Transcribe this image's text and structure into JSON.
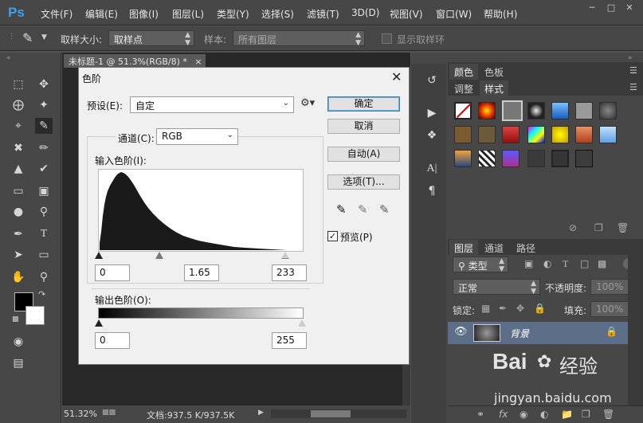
{
  "app": {
    "logo": "Ps"
  },
  "menu": [
    "文件(F)",
    "编辑(E)",
    "图像(I)",
    "图层(L)",
    "类型(Y)",
    "选择(S)",
    "滤镜(T)",
    "3D(D)",
    "视图(V)",
    "窗口(W)",
    "帮助(H)"
  ],
  "options": {
    "sample_size_label": "取样大小:",
    "sample_size_value": "取样点",
    "sample_label": "样本:",
    "sample_value": "所有图层",
    "show_ring_label": "显示取样环"
  },
  "document": {
    "tab_title": "未标题-1 @ 51.3%(RGB/8) *",
    "zoom": "51.32%",
    "doc_size": "文档:937.5 K/937.5K"
  },
  "dialog": {
    "title": "色阶",
    "preset_label": "预设(E):",
    "preset_value": "自定",
    "channel_label": "通道(C):",
    "channel_value": "RGB",
    "input_levels_label": "输入色阶(I):",
    "input_black": "0",
    "input_gamma": "1.65",
    "input_white": "233",
    "output_levels_label": "输出色阶(O):",
    "output_black": "0",
    "output_white": "255",
    "ok_label": "确定",
    "cancel_label": "取消",
    "auto_label": "自动(A)",
    "options_label": "选项(T)...",
    "preview_label": "预览(P)",
    "preview_checked": true
  },
  "panels": {
    "tab_color": "颜色",
    "tab_swatches": "色板",
    "tab_adjust": "调整",
    "tab_styles": "样式",
    "tab_layers": "图层",
    "tab_channels": "通道",
    "tab_paths": "路径",
    "kind_label": "类型",
    "blend_mode": "正常",
    "opacity_label": "不透明度:",
    "opacity_value": "100%",
    "lock_label": "锁定:",
    "fill_label": "填充:",
    "fill_value": "100%",
    "layer_name": "背景"
  },
  "watermark": {
    "brand": "Bai",
    "brand2": "经验",
    "url": "jingyan.baidu.com"
  },
  "colors": {
    "ps_blue": "#3aa0ef",
    "panel": "#474747",
    "dialog_bg": "#f0f0f0",
    "layer_selected": "#5d6e88"
  }
}
